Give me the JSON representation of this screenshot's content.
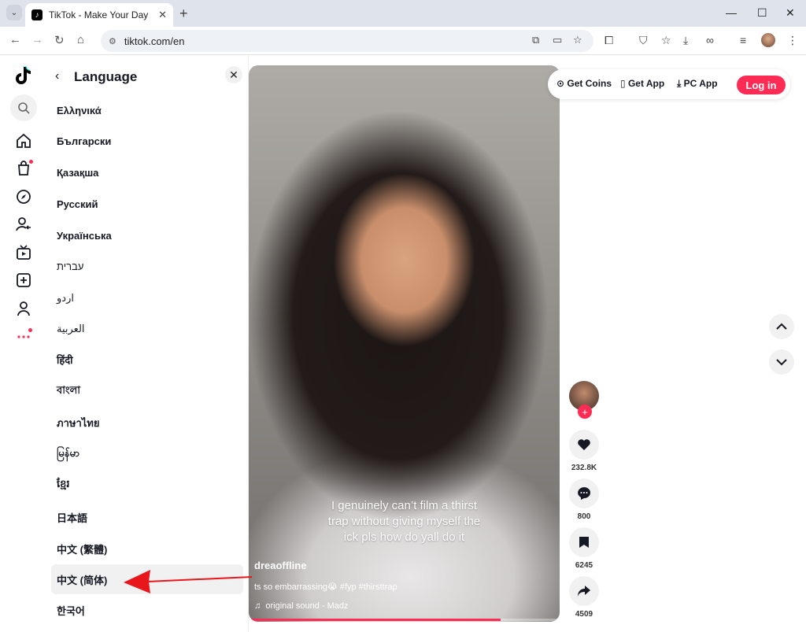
{
  "browser": {
    "tab_title": "TikTok - Make Your Day",
    "url": "tiktok.com/en"
  },
  "lang_panel": {
    "title": "Language",
    "languages": [
      "Ελληνικά",
      "Български",
      "Қазақша",
      "Русский",
      "Українська",
      "עברית",
      "اردو",
      "العربية",
      "हिंदी",
      "বাংলা",
      "ภาษาไทย",
      "မြန်မာ",
      "ខ្មែរ",
      "日本語",
      "中文 (繁體)",
      "中文 (简体)",
      "한국어"
    ],
    "selected": "中文 (简体)"
  },
  "video": {
    "caption_lines": [
      "I genuinely can’t film a thirst",
      "trap without giving myself the",
      "ick pls how do yall do it"
    ],
    "author": "dreaoffline",
    "description": "ts so embarrassing😭 #fyp #thirsttrap",
    "sound": "original sound - Madz",
    "progress": 0.81
  },
  "actions": {
    "likes": "232.8K",
    "comments": "800",
    "saves": "6245",
    "shares": "4509"
  },
  "topbar": {
    "get_coins": "Get Coins",
    "get_app": "Get App",
    "pc_app": "PC App",
    "login": "Log in"
  },
  "colors": {
    "accent": "#fe2c55"
  }
}
